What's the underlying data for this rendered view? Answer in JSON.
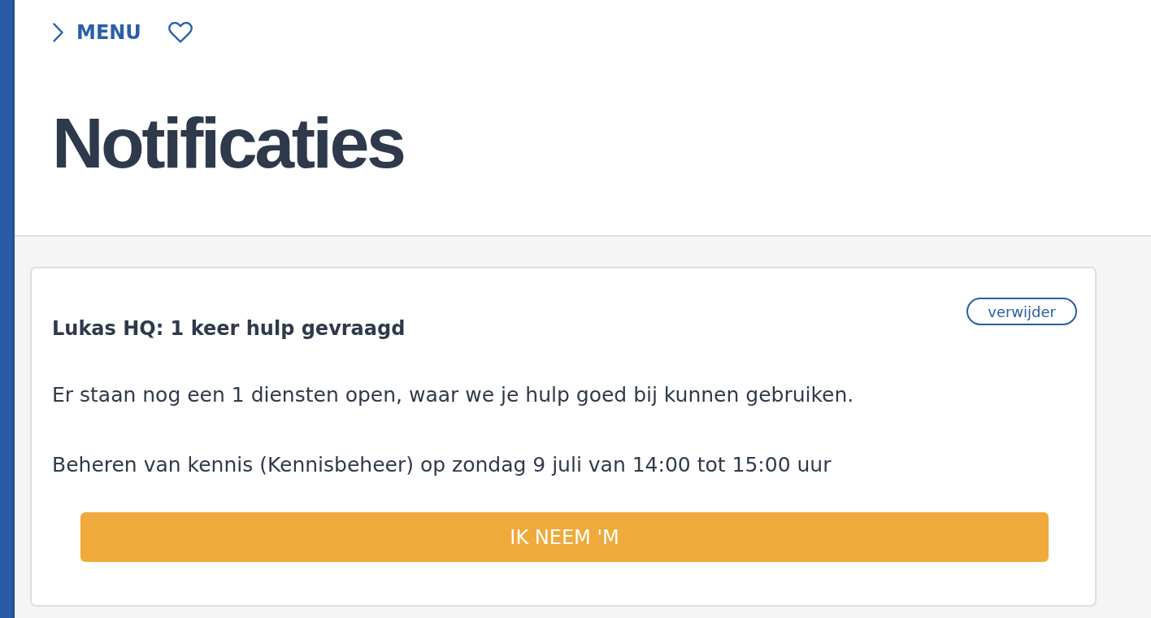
{
  "nav": {
    "menu_label": "MENU"
  },
  "page_title": "Notificaties",
  "notifications": [
    {
      "title": "Lukas HQ: 1 keer hulp gevraagd",
      "remove_label": "verwijder",
      "message": "Er staan nog een 1 diensten open, waar we je hulp goed bij kunnen gebruiken.",
      "shift": "Beheren van kennis (Kennisbeheer) op zondag 9 juli van 14:00 tot 15:00 uur",
      "action_label": "IK NEEM 'M"
    }
  ]
}
